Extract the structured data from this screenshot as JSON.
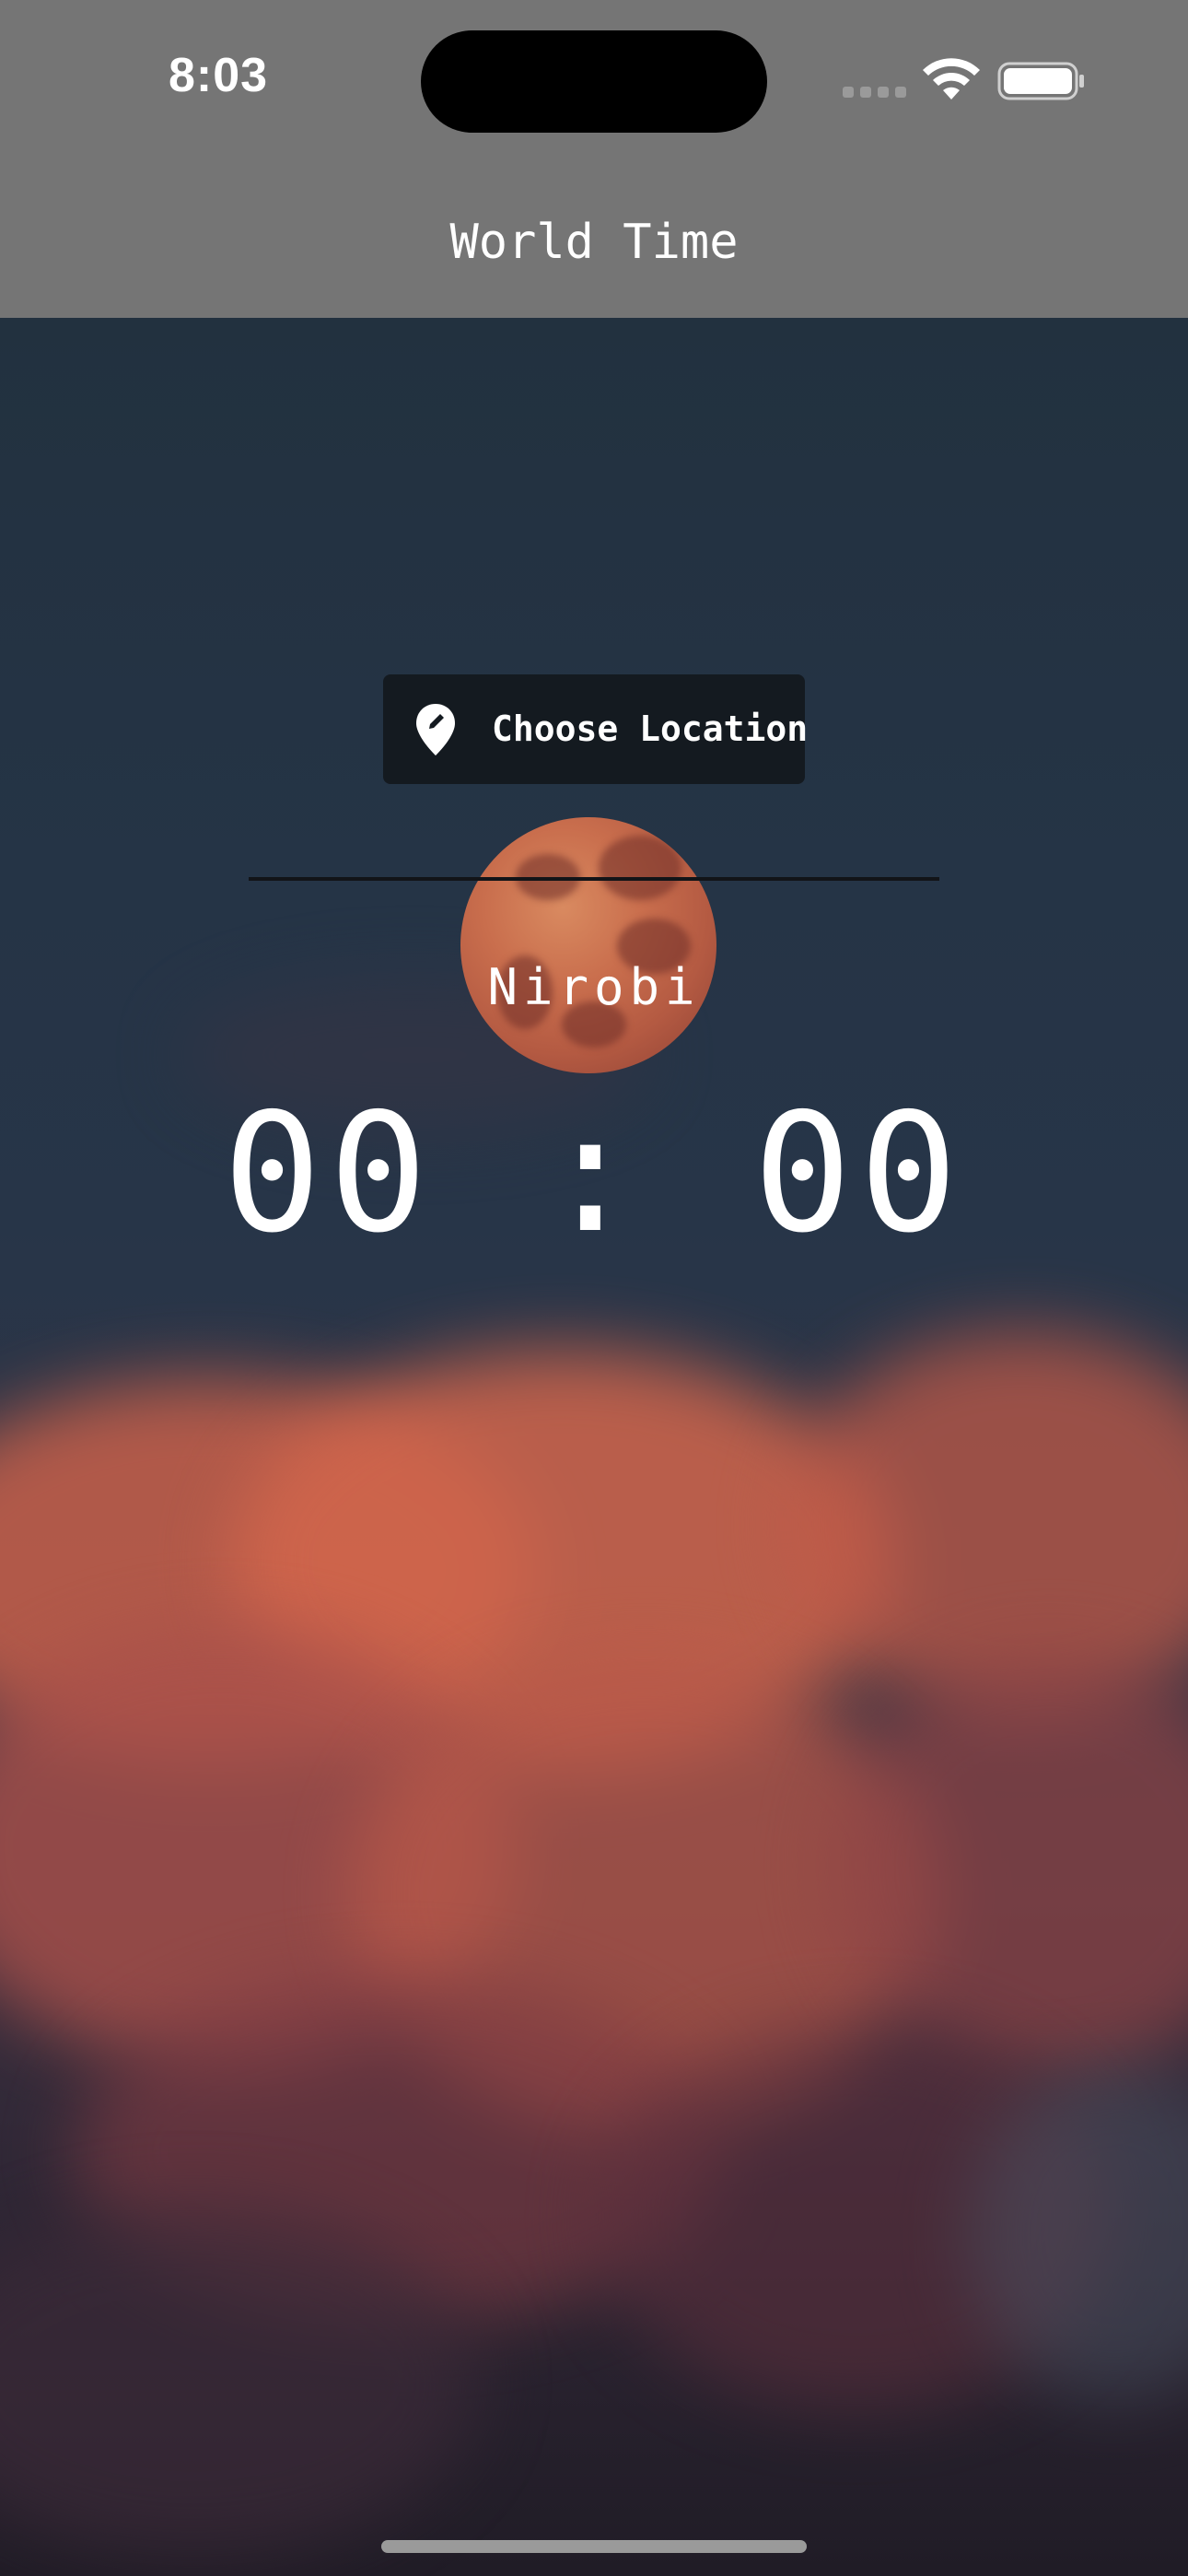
{
  "status_bar": {
    "time": "8:03",
    "wifi_icon": "wifi-icon",
    "battery_icon": "battery-icon"
  },
  "app_bar": {
    "title": "World Time"
  },
  "location_button": {
    "icon": "location-edit-icon",
    "label": "Choose Location"
  },
  "location": {
    "name": "Nirobi"
  },
  "clock": {
    "time": "00 : 00"
  },
  "colors": {
    "app_bar": "#757575",
    "button_bg": "#141a20",
    "text": "#ffffff"
  }
}
